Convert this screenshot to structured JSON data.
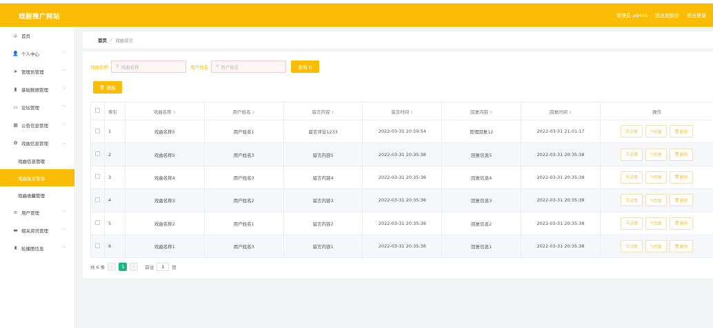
{
  "header": {
    "title": "戏剧推广网站",
    "user_label": "管理员 admin",
    "frontend_link": "退出到前台",
    "logout_link": "退出登录"
  },
  "sidebar": {
    "items": [
      {
        "label": "首页",
        "icon": "home-icon",
        "glyph": "⌂",
        "chevron": false
      },
      {
        "label": "个人中心",
        "icon": "user-icon",
        "glyph": "👤",
        "chevron": true
      },
      {
        "label": "管理员管理",
        "icon": "send-icon",
        "glyph": "➤",
        "chevron": true
      },
      {
        "label": "基础数据管理",
        "icon": "trash-icon",
        "glyph": "▮",
        "chevron": true
      },
      {
        "label": "论坛管理",
        "icon": "chat-icon",
        "glyph": "▭",
        "chevron": true
      },
      {
        "label": "公告信息管理",
        "icon": "grid-icon",
        "glyph": "▦",
        "chevron": true
      },
      {
        "label": "戏曲信息管理",
        "icon": "flower-icon",
        "glyph": "✿",
        "chevron": "up"
      }
    ],
    "sub_items": [
      "戏曲信息管理",
      "戏曲留言管理",
      "戏曲收藏管理"
    ],
    "bottom_items": [
      {
        "label": "用户管理",
        "icon": "menu-icon",
        "glyph": "≡"
      },
      {
        "label": "相关资讯管理",
        "icon": "box-icon",
        "glyph": "▬"
      },
      {
        "label": "轮播图信息",
        "icon": "ticket-icon",
        "glyph": "♜"
      }
    ]
  },
  "breadcrumb": {
    "home": "首页",
    "sep": "/",
    "current": "戏曲留言"
  },
  "search": {
    "label1": "戏曲名称",
    "placeholder1": "戏曲名称",
    "label2": "用户姓名",
    "placeholder2": "用户姓名",
    "button": "查询 Q"
  },
  "delete_button": "删除",
  "table": {
    "headers": [
      "索引",
      "戏曲名称",
      "用户姓名",
      "留言内容",
      "留言时间",
      "回复内容",
      "回复时间",
      "操作"
    ],
    "rows": [
      [
        "1",
        "戏曲名称5",
        "用户姓名1",
        "留言评论1233",
        "2022-03-31 20:59:54",
        "管理回复12",
        "2022-03-31 21:01:17"
      ],
      [
        "2",
        "戏曲名称5",
        "用户姓名3",
        "留言内容5",
        "2022-03-31 20:35:38",
        "回复信息5",
        "2022-03-31 20:35:38"
      ],
      [
        "3",
        "戏曲名称4",
        "用户姓名3",
        "留言内容4",
        "2022-03-31 20:35:38",
        "回复信息4",
        "2022-03-31 20:35:38"
      ],
      [
        "4",
        "戏曲名称3",
        "用户姓名2",
        "留言内容3",
        "2022-03-31 20:35:38",
        "回复信息3",
        "2022-03-31 20:35:38"
      ],
      [
        "5",
        "戏曲名称2",
        "用户姓名1",
        "留言内容2",
        "2022-03-31 20:35:38",
        "回复信息2",
        "2022-03-31 20:35:38"
      ],
      [
        "6",
        "戏曲名称1",
        "用户姓名3",
        "留言内容1",
        "2022-03-31 20:35:38",
        "回复信息1",
        "2022-03-31 20:35:38"
      ]
    ],
    "ops": [
      "详情",
      "回复",
      "删除"
    ]
  },
  "pager": {
    "total": "共 6 条",
    "current": "1",
    "goto_label": "前往",
    "goto_value": "1",
    "page_suffix": "页"
  },
  "colors": {
    "accent": "#fbbc05",
    "pager_active": "#16b97c"
  }
}
